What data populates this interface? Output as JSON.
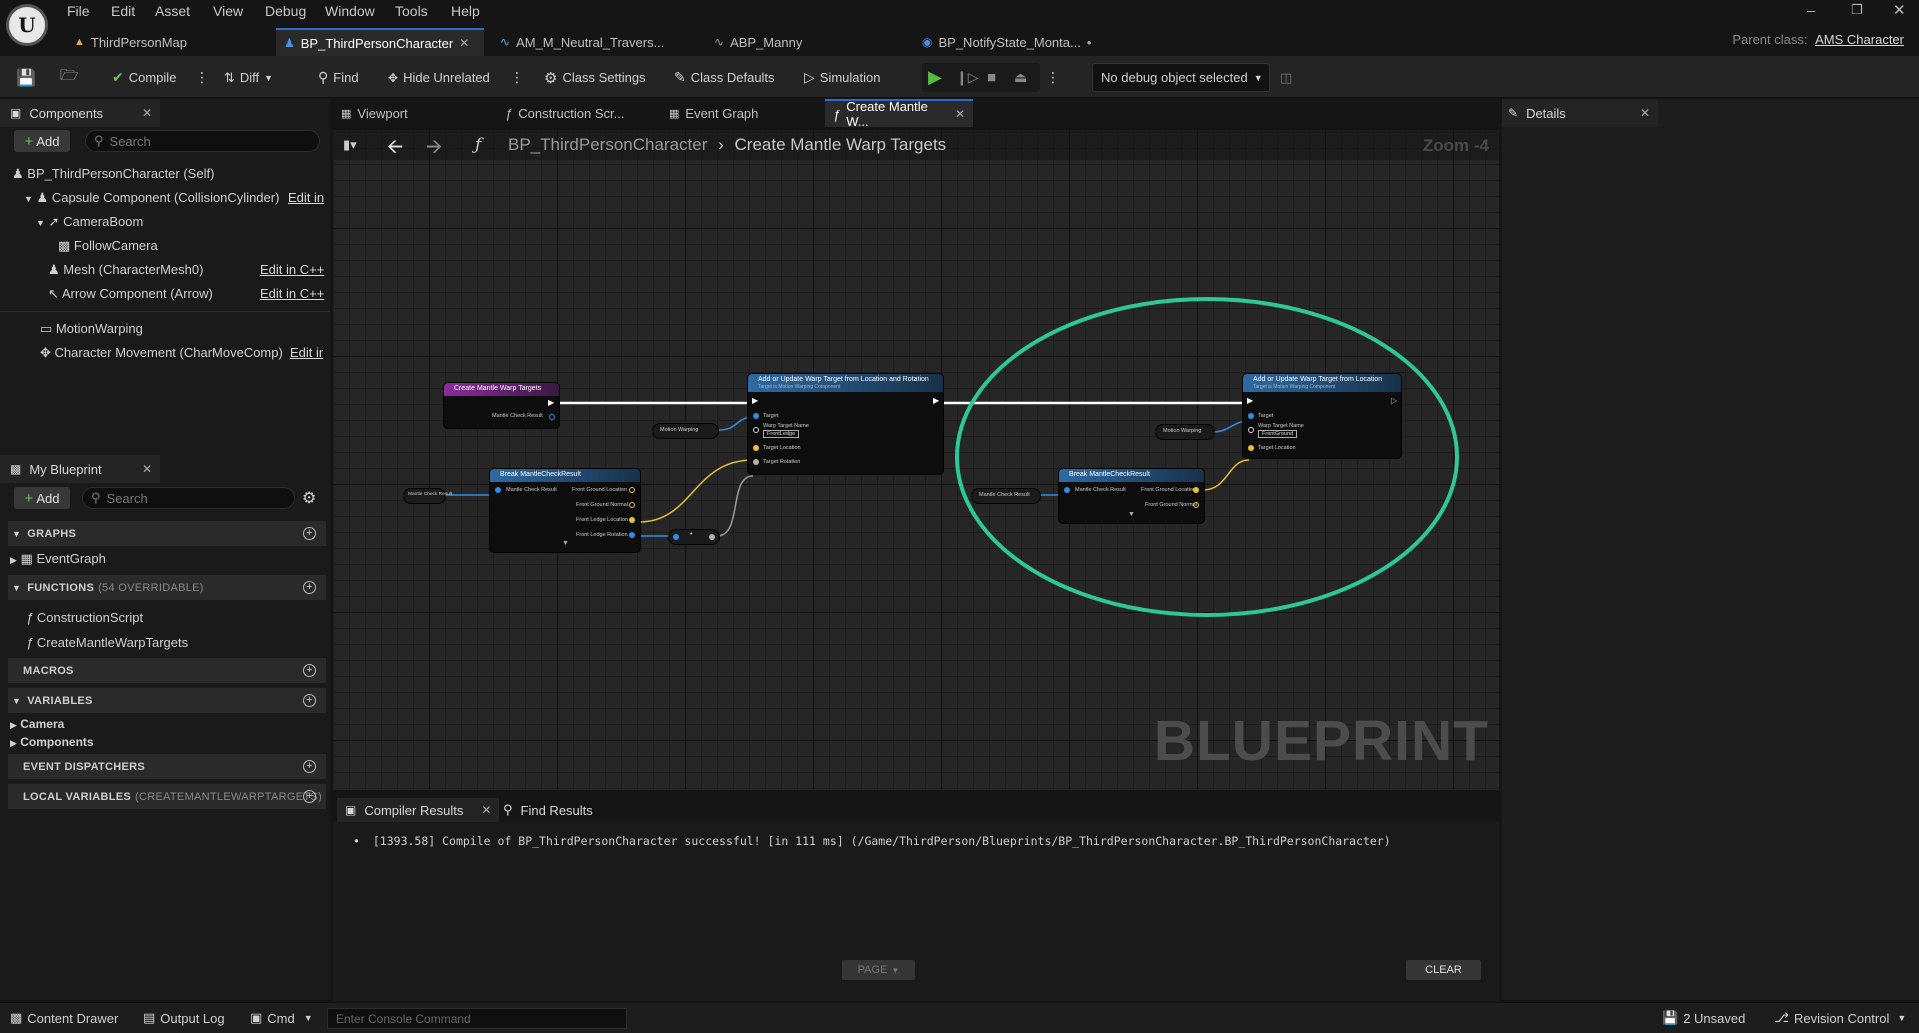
{
  "menu": [
    "File",
    "Edit",
    "Asset",
    "View",
    "Debug",
    "Window",
    "Tools",
    "Help"
  ],
  "tabs": [
    {
      "label": "ThirdPersonMap"
    },
    {
      "label": "BP_ThirdPersonCharacter"
    },
    {
      "label": "AM_M_Neutral_Travers..."
    },
    {
      "label": "ABP_Manny"
    },
    {
      "label": "BP_NotifyState_Monta..."
    }
  ],
  "parent_class": {
    "label": "Parent class:",
    "value": "AMS Character"
  },
  "toolbar": {
    "compile": "Compile",
    "diff": "Diff",
    "find": "Find",
    "hide_unrelated": "Hide Unrelated",
    "class_settings": "Class Settings",
    "class_defaults": "Class Defaults",
    "simulation": "Simulation",
    "debug_object": "No debug object selected"
  },
  "components": {
    "title": "Components",
    "add": "Add",
    "search_placeholder": "Search",
    "items": [
      {
        "label": "BP_ThirdPersonCharacter (Self)"
      },
      {
        "label": "Capsule Component (CollisionCylinder)",
        "link": "Edit in"
      },
      {
        "label": "CameraBoom"
      },
      {
        "label": "FollowCamera"
      },
      {
        "label": "Mesh (CharacterMesh0)",
        "link": "Edit in C++"
      },
      {
        "label": "Arrow Component (Arrow)",
        "link": "Edit in C++"
      },
      {
        "label": "MotionWarping"
      },
      {
        "label": "Character Movement (CharMoveComp)",
        "link": "Edit ir"
      }
    ]
  },
  "my_blueprint": {
    "title": "My Blueprint",
    "add": "Add",
    "search_placeholder": "Search",
    "graphs": "GRAPHS",
    "event_graph": "EventGraph",
    "functions": "FUNCTIONS",
    "functions_count": "(54 OVERRIDABLE)",
    "construction_script": "ConstructionScript",
    "create_mantle": "CreateMantleWarpTargets",
    "macros": "MACROS",
    "variables": "VARIABLES",
    "camera": "Camera",
    "components_cat": "Components",
    "event_dispatchers": "EVENT DISPATCHERS",
    "local_variables": "LOCAL VARIABLES",
    "local_variables_scope": "(CREATEMANTLEWARPTARGETS)"
  },
  "graph_tabs": [
    {
      "label": "Viewport"
    },
    {
      "label": "Construction Scr..."
    },
    {
      "label": "Event Graph"
    },
    {
      "label": "Create Mantle W..."
    }
  ],
  "breadcrumb": {
    "root": "BP_ThirdPersonCharacter",
    "current": "Create Mantle Warp Targets",
    "zoom": "Zoom -4"
  },
  "watermark": "BLUEPRINT",
  "nodes": {
    "entry_title": "Create Mantle Warp Targets",
    "entry_pin": "Mantle Check Result",
    "add_rot_title": "Add or Update Warp Target from Location and Rotation",
    "add_sub": "Target is Motion Warping Component",
    "pin_target": "Target",
    "pin_warp_name": "Warp Target Name",
    "val_front_ledge": "FrontLedge",
    "pin_target_location": "Target Location",
    "pin_target_rotation": "Target Rotation",
    "motion_warping": "Motion Warping",
    "break_title": "Break MantleCheckResult",
    "pin_mantle_check": "Mantle Check Result",
    "pin_fgl": "Front Ground Location",
    "pin_fgn": "Front Ground Normal",
    "pin_fll": "Front Ledge Location",
    "pin_flr": "Front Ledge Rotation",
    "add_loc_title": "Add or Update Warp Target from Location",
    "val_front_ground": "FrontGround"
  },
  "details": {
    "title": "Details"
  },
  "bottom": {
    "tab_compiler": "Compiler Results",
    "tab_find": "Find Results",
    "log": "[1393.58] Compile of BP_ThirdPersonCharacter successful! [in 111 ms] (/Game/ThirdPerson/Blueprints/BP_ThirdPersonCharacter.BP_ThirdPersonCharacter)",
    "page": "PAGE",
    "clear": "CLEAR"
  },
  "statusbar": {
    "content_drawer": "Content Drawer",
    "output_log": "Output Log",
    "cmd": "Cmd",
    "console_placeholder": "Enter Console Command",
    "unsaved": "2 Unsaved",
    "revision": "Revision Control"
  },
  "colors": {
    "accent": "#2b6ccf",
    "annotation": "#2dc79a",
    "play": "#58b840"
  }
}
